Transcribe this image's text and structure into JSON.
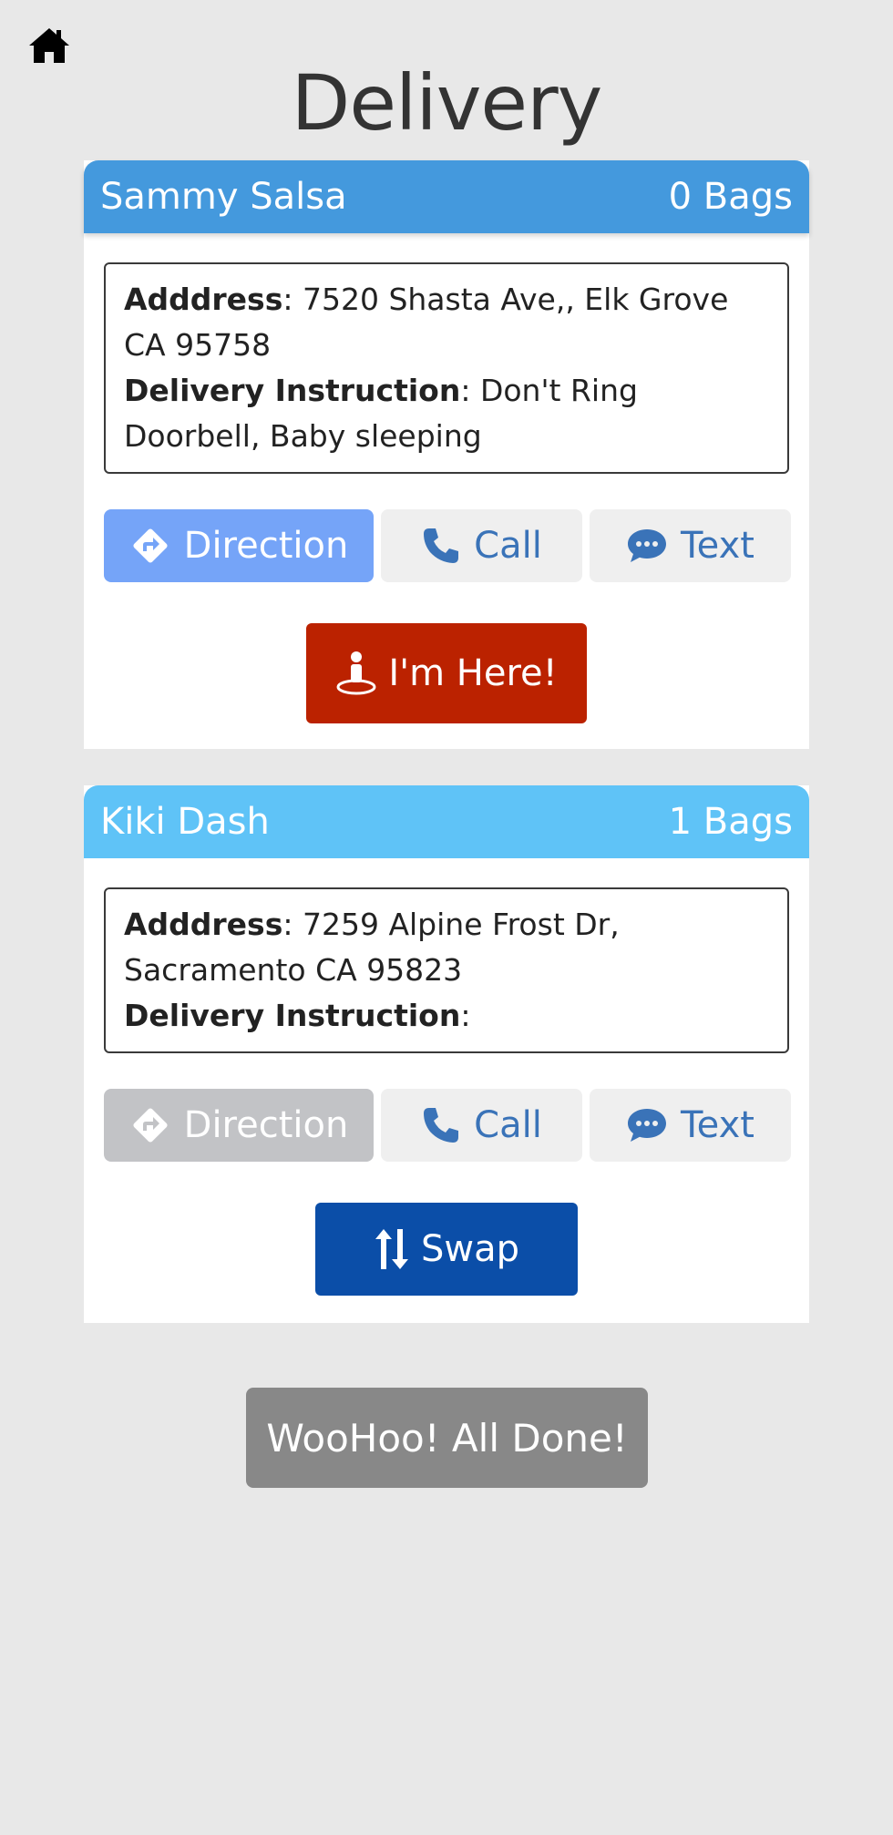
{
  "header": {
    "title": "Delivery",
    "home_icon": "home-icon"
  },
  "deliveries": [
    {
      "name": "Sammy Salsa",
      "bags": "0 Bags",
      "address_label": "Adddress",
      "address": "7520 Shasta Ave,, Elk Grove CA 95758",
      "instruction_label": "Delivery Instruction",
      "instruction": "Don't Ring Doorbell, Baby sleeping",
      "direction_label": "Direction",
      "call_label": "Call",
      "text_label": "Text",
      "action_label": "I'm Here!",
      "header_color": "#4499dd",
      "direction_state": "active"
    },
    {
      "name": "Kiki Dash",
      "bags": "1 Bags",
      "address_label": "Adddress",
      "address": "7259 Alpine Frost Dr, Sacramento CA 95823",
      "instruction_label": "Delivery Instruction",
      "instruction": "",
      "direction_label": "Direction",
      "call_label": "Call",
      "text_label": "Text",
      "action_label": "Swap",
      "header_color": "#5fc3f7",
      "direction_state": "disabled"
    }
  ],
  "footer": {
    "done_label": "WooHoo! All Done!"
  },
  "colors": {
    "background": "#e8e8e8",
    "here_button": "#bb2200",
    "swap_button": "#0b4ea8",
    "done_button": "#888888",
    "link_blue": "#3a73b8"
  }
}
